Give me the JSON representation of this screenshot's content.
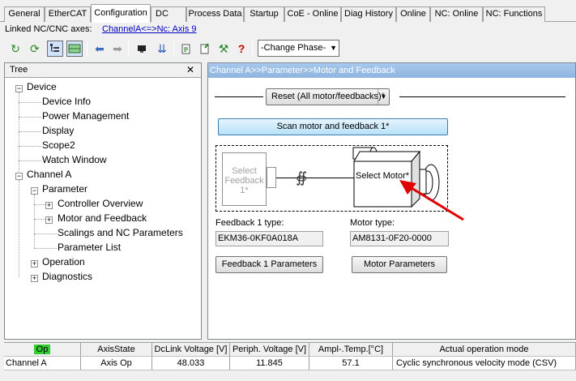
{
  "tabs": [
    "General",
    "EtherCAT",
    "Configuration",
    "DC",
    "Process Data",
    "Startup",
    "CoE - Online",
    "Diag History",
    "Online",
    "NC: Online",
    "NC: Functions"
  ],
  "active_tab": "Configuration",
  "linked": {
    "label": "Linked NC/CNC axes:",
    "link": "ChannelA<=>Nc: Axis 9"
  },
  "toolbar": {
    "phase": "-Change Phase-"
  },
  "tree": {
    "title": "Tree",
    "close": "✕",
    "items": [
      "Device",
      "Device Info",
      "Power Management",
      "Display",
      "Scope2",
      "Watch Window",
      "Channel A",
      "Parameter",
      "Controller Overview",
      "Motor and Feedback",
      "Scalings and NC Parameters",
      "Parameter List",
      "Operation",
      "Diagnostics"
    ]
  },
  "panel": {
    "title": "Channel A>>Parameter>>Motor and Feedback",
    "reset_label": "Reset (All motor/feedbacks)*",
    "scan_label": "Scan motor and feedback 1*",
    "select_feedback": [
      "Select",
      "Feedback 1*"
    ],
    "select_motor": "Select Motor*",
    "feedback_type_label": "Feedback 1 type:",
    "feedback_type_value": "EKM36-0KF0A018A",
    "motor_type_label": "Motor type:",
    "motor_type_value": "AM8131-0F20-0000",
    "feedback_params_label": "Feedback 1 Parameters",
    "motor_params_label": "Motor Parameters"
  },
  "status": {
    "headers": [
      "Op",
      "AxisState",
      "DcLink Voltage [V]",
      "Periph. Voltage [V]",
      "Ampl-.Temp.[°C]",
      "Actual operation mode"
    ],
    "row": [
      "Channel A",
      "Axis Op",
      "48.033",
      "11.845",
      "57.1",
      "Cyclic synchronous velocity mode (CSV)"
    ]
  },
  "colors": {
    "op_green": "#32cd32",
    "title_blue": "#9bbfe8",
    "arrow_red": "#e00000",
    "link_blue": "#0000c0"
  }
}
